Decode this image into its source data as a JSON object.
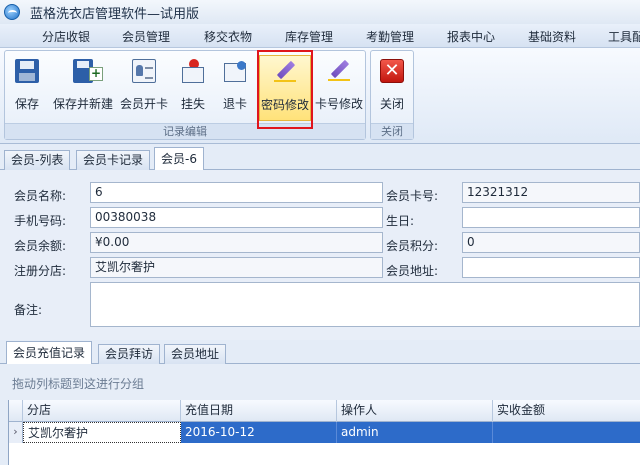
{
  "app": {
    "title": "蓝格洗衣店管理软件—试用版"
  },
  "menu": {
    "items": [
      "分店收银",
      "会员管理",
      "移交衣物",
      "库存管理",
      "考勤管理",
      "报表中心",
      "基础资料",
      "工具配"
    ]
  },
  "ribbon": {
    "group1_label": "记录编辑",
    "group2_label": "关闭",
    "buttons": {
      "save": "保存",
      "save_new": "保存并新建",
      "open_card": "会员开卡",
      "report_loss": "挂失",
      "return_card": "退卡",
      "change_password": "密码修改",
      "change_card_no": "卡号修改",
      "close": "关闭"
    }
  },
  "doc_tabs": [
    "会员-列表",
    "会员卡记录",
    "会员-6"
  ],
  "form": {
    "member_name_label": "会员名称:",
    "member_name": "6",
    "card_no_label": "会员卡号:",
    "card_no": "12321312",
    "phone_label": "手机号码:",
    "phone": "00380038",
    "birthday_label": "生日:",
    "birthday": "",
    "balance_label": "会员余额:",
    "balance": "¥0.00",
    "points_label": "会员积分:",
    "points": "0",
    "branch_label": "注册分店:",
    "branch": "艾凯尔奢护",
    "address_label": "会员地址:",
    "address": "",
    "notes_label": "备注:",
    "notes": ""
  },
  "sub_tabs": [
    "会员充值记录",
    "会员拜访",
    "会员地址"
  ],
  "group_hint": "拖动列标题到这进行分组",
  "grid": {
    "columns": [
      "分店",
      "充值日期",
      "操作人",
      "实收金额"
    ],
    "rows": [
      {
        "branch": "艾凯尔奢护",
        "date": "2016-10-12",
        "operator": "admin",
        "amount": ""
      }
    ]
  },
  "colors": {
    "accent_highlight": "#ffe27a",
    "selection_blue": "#2d6bc9",
    "red_box": "#e0151d"
  }
}
